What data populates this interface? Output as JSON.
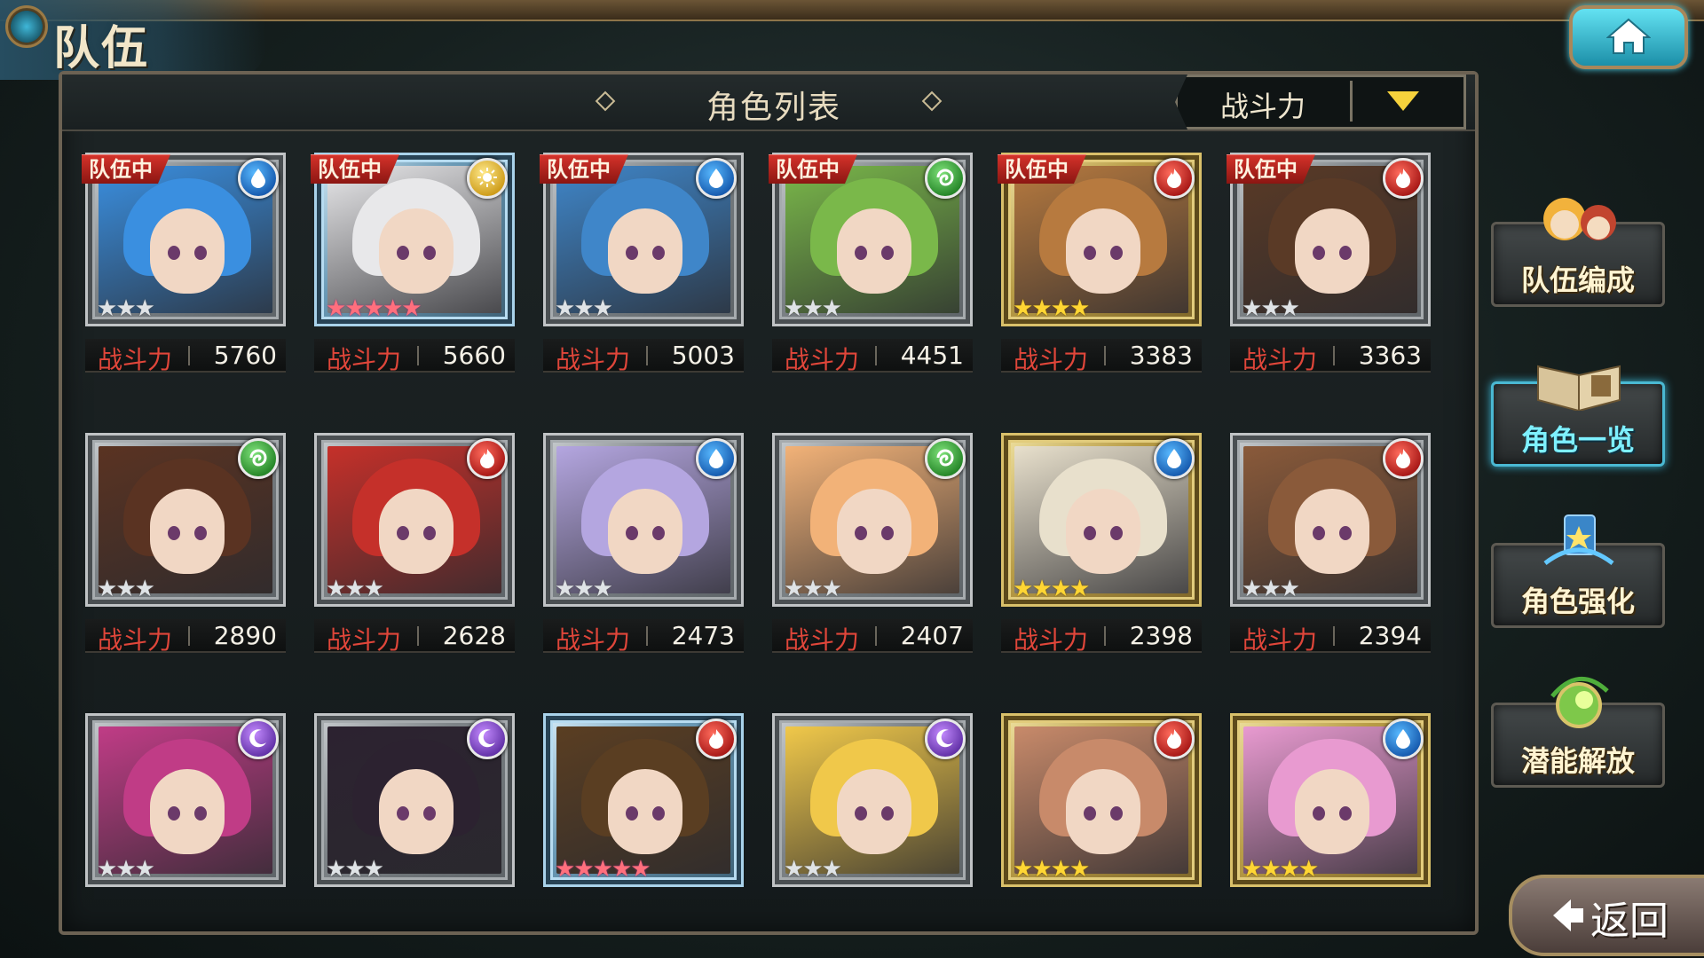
{
  "header": {
    "title": "队伍"
  },
  "list": {
    "title": "角色列表",
    "sort": {
      "selected": "战斗力"
    },
    "power_label": "战斗力"
  },
  "side_menu": [
    {
      "label": "队伍编成",
      "active": false
    },
    {
      "label": "角色一览",
      "active": true
    },
    {
      "label": "角色强化",
      "active": false
    },
    {
      "label": "潜能解放",
      "active": false
    }
  ],
  "back_label": "返回",
  "party_tag": "队伍中",
  "characters": [
    {
      "in_party": true,
      "element": "water",
      "stars": 3,
      "rarity": "silver",
      "power": "5760",
      "hair": "#3a8fe0",
      "frame": "silver"
    },
    {
      "in_party": true,
      "element": "light",
      "stars": 5,
      "rarity": "rainbow",
      "power": "5660",
      "hair": "#e8e8ea",
      "frame": "blue"
    },
    {
      "in_party": true,
      "element": "water",
      "stars": 3,
      "rarity": "silver",
      "power": "5003",
      "hair": "#3f86c9",
      "frame": "silver"
    },
    {
      "in_party": true,
      "element": "wind",
      "stars": 3,
      "rarity": "silver",
      "power": "4451",
      "hair": "#7ab84a",
      "frame": "silver"
    },
    {
      "in_party": true,
      "element": "fire",
      "stars": 4,
      "rarity": "gold",
      "power": "3383",
      "hair": "#b77a3f",
      "frame": "gold"
    },
    {
      "in_party": true,
      "element": "fire",
      "stars": 3,
      "rarity": "silver",
      "power": "3363",
      "hair": "#5a3a26",
      "frame": "silver"
    },
    {
      "in_party": false,
      "element": "wind",
      "stars": 3,
      "rarity": "silver",
      "power": "2890",
      "hair": "#5a3322",
      "frame": "silver"
    },
    {
      "in_party": false,
      "element": "fire",
      "stars": 3,
      "rarity": "silver",
      "power": "2628",
      "hair": "#c5302a",
      "frame": "silver"
    },
    {
      "in_party": false,
      "element": "water",
      "stars": 3,
      "rarity": "silver",
      "power": "2473",
      "hair": "#b4a6e0",
      "frame": "silver"
    },
    {
      "in_party": false,
      "element": "wind",
      "stars": 3,
      "rarity": "silver",
      "power": "2407",
      "hair": "#f2b278",
      "frame": "silver"
    },
    {
      "in_party": false,
      "element": "water",
      "stars": 4,
      "rarity": "gold",
      "power": "2398",
      "hair": "#e8e0cc",
      "frame": "gold"
    },
    {
      "in_party": false,
      "element": "fire",
      "stars": 3,
      "rarity": "silver",
      "power": "2394",
      "hair": "#8a5a3a",
      "frame": "silver"
    },
    {
      "in_party": false,
      "element": "dark",
      "stars": 3,
      "rarity": "silver",
      "power": "",
      "hair": "#c03c86",
      "frame": "silver"
    },
    {
      "in_party": false,
      "element": "dark",
      "stars": 3,
      "rarity": "silver",
      "power": "",
      "hair": "#2c2230",
      "frame": "silver"
    },
    {
      "in_party": false,
      "element": "fire",
      "stars": 5,
      "rarity": "rainbow",
      "power": "",
      "hair": "#5a3e22",
      "frame": "blue"
    },
    {
      "in_party": false,
      "element": "dark",
      "stars": 3,
      "rarity": "silver",
      "power": "",
      "hair": "#f0c84a",
      "frame": "silver"
    },
    {
      "in_party": false,
      "element": "fire",
      "stars": 4,
      "rarity": "gold",
      "power": "",
      "hair": "#c88a6a",
      "frame": "gold"
    },
    {
      "in_party": false,
      "element": "water",
      "stars": 4,
      "rarity": "gold",
      "power": "",
      "hair": "#e89ad0",
      "frame": "gold"
    }
  ],
  "icons": {
    "home": "home-icon",
    "back": "arrow-left-icon",
    "sort": "triangle-down-icon"
  }
}
